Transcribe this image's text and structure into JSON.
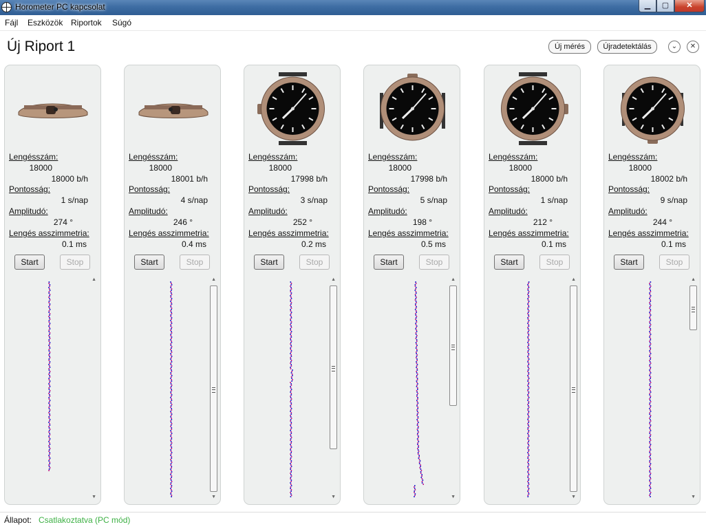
{
  "window": {
    "title": "Horometer PC kapcsolat",
    "minimize": "▁",
    "maximize": "▢",
    "close": "✕"
  },
  "menu": [
    "Fájl",
    "Eszközök",
    "Riportok",
    "Súgó"
  ],
  "report": {
    "title": "Új Riport 1"
  },
  "header_buttons": {
    "new_measure": "Új mérés",
    "redetect": "Újradetektálás"
  },
  "labels": {
    "beat": "Lengésszám:",
    "rate": "Pontosság:",
    "amplitude": "Amplitudó:",
    "asym": "Lengés asszimmetria:",
    "start": "Start",
    "stop": "Stop"
  },
  "watches": [
    {
      "view": "side-crown-right",
      "beat_nominal": "18000",
      "beat_measured": "18000 b/h",
      "rate": "1 s/nap",
      "amplitude": "274 °",
      "asym": "0.1 ms",
      "trace_scroll": false
    },
    {
      "view": "side-crown-left",
      "beat_nominal": "18000",
      "beat_measured": "18001 b/h",
      "rate": "4 s/nap",
      "amplitude": "246 °",
      "asym": "0.4 ms",
      "trace_scroll": true
    },
    {
      "view": "dial-6-up",
      "beat_nominal": "18000",
      "beat_measured": "17998 b/h",
      "rate": "3 s/nap",
      "amplitude": "252 °",
      "asym": "0.2 ms",
      "trace_scroll": true
    },
    {
      "view": "dial-crown-up",
      "beat_nominal": "18000",
      "beat_measured": "17998 b/h",
      "rate": "5 s/nap",
      "amplitude": "198 °",
      "asym": "0.5 ms",
      "trace_scroll": true
    },
    {
      "view": "dial-crown-right",
      "beat_nominal": "18000",
      "beat_measured": "18000 b/h",
      "rate": "1 s/nap",
      "amplitude": "212 °",
      "asym": "0.1 ms",
      "trace_scroll": true
    },
    {
      "view": "dial-crown-down",
      "beat_nominal": "18000",
      "beat_measured": "18002 b/h",
      "rate": "9 s/nap",
      "amplitude": "244 °",
      "asym": "0.1 ms",
      "trace_scroll": true
    }
  ],
  "status": {
    "label": "Állapot:",
    "value": "Csatlakoztatva (PC mód)"
  },
  "colors": {
    "trace_a": "#2a2ad0",
    "trace_b": "#c0208a",
    "status_ok": "#3cb043",
    "panel_bg": "#eef0ef"
  }
}
